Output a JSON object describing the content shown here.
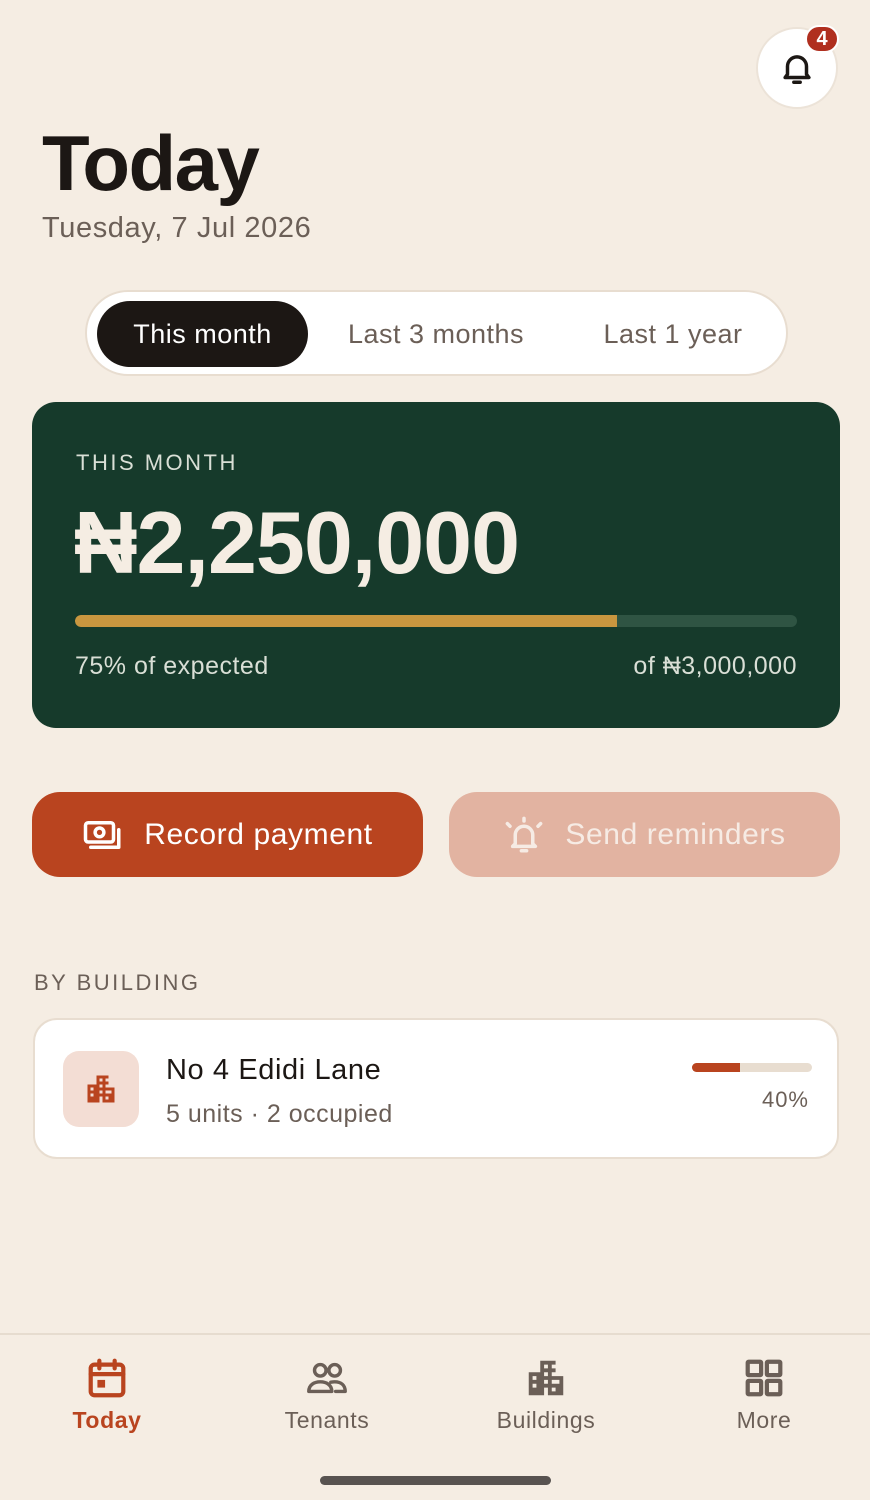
{
  "header": {
    "title": "Today",
    "date": "Tuesday, 7 Jul 2026",
    "notification_count": "4"
  },
  "range_tabs": [
    {
      "label": "This month",
      "active": true
    },
    {
      "label": "Last 3 months",
      "active": false
    },
    {
      "label": "Last 1 year",
      "active": false
    }
  ],
  "summary": {
    "label": "THIS MONTH",
    "amount": "₦2,250,000",
    "progress_percent": 75,
    "percent_text": "75% of expected",
    "expected_text": "of ₦3,000,000"
  },
  "actions": {
    "record_label": "Record payment",
    "reminders_label": "Send reminders"
  },
  "by_building": {
    "section_label": "BY BUILDING",
    "items": [
      {
        "name": "No 4 Edidi Lane",
        "meta": "5 units · 2 occupied",
        "percent": 40,
        "percent_text": "40%"
      }
    ]
  },
  "nav": {
    "items": [
      {
        "label": "Today",
        "icon": "calendar-icon",
        "active": true
      },
      {
        "label": "Tenants",
        "icon": "people-icon",
        "active": false
      },
      {
        "label": "Buildings",
        "icon": "building-icon",
        "active": false
      },
      {
        "label": "More",
        "icon": "grid-icon",
        "active": false
      }
    ]
  },
  "colors": {
    "background": "#f5ede3",
    "hero": "#163a2b",
    "accent": "#b9441f",
    "progress": "#c9963f"
  }
}
